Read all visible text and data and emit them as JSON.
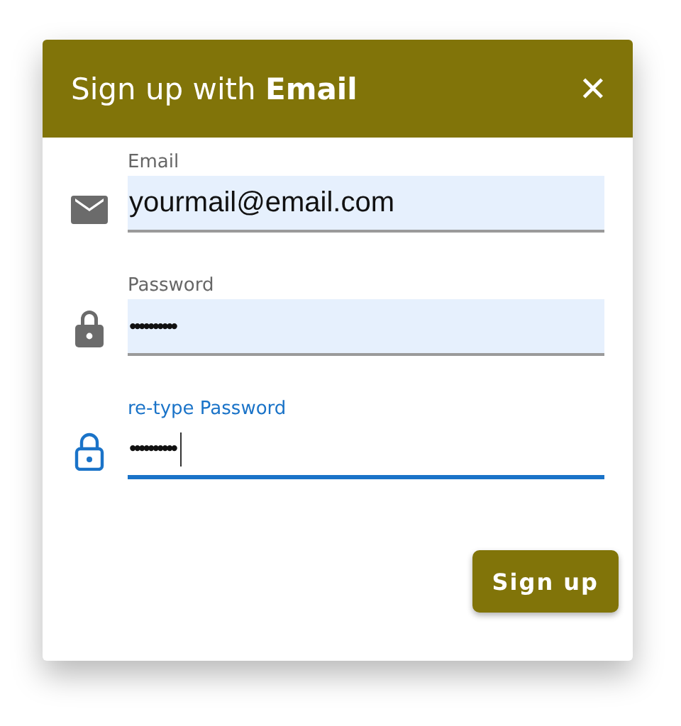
{
  "dialog": {
    "title": "Sign up with **Email**",
    "close": "✕"
  },
  "fields": [
    {
      "label": "Email",
      "value": "yourmail@email.com",
      "kind": "email",
      "focused": false
    },
    {
      "label": "Password",
      "value": "••••••••••",
      "kind": "password",
      "focused": false
    },
    {
      "label": "re-type Password",
      "value": "••••••••••",
      "kind": "password",
      "focused": true
    }
  ],
  "button": "Sign up"
}
